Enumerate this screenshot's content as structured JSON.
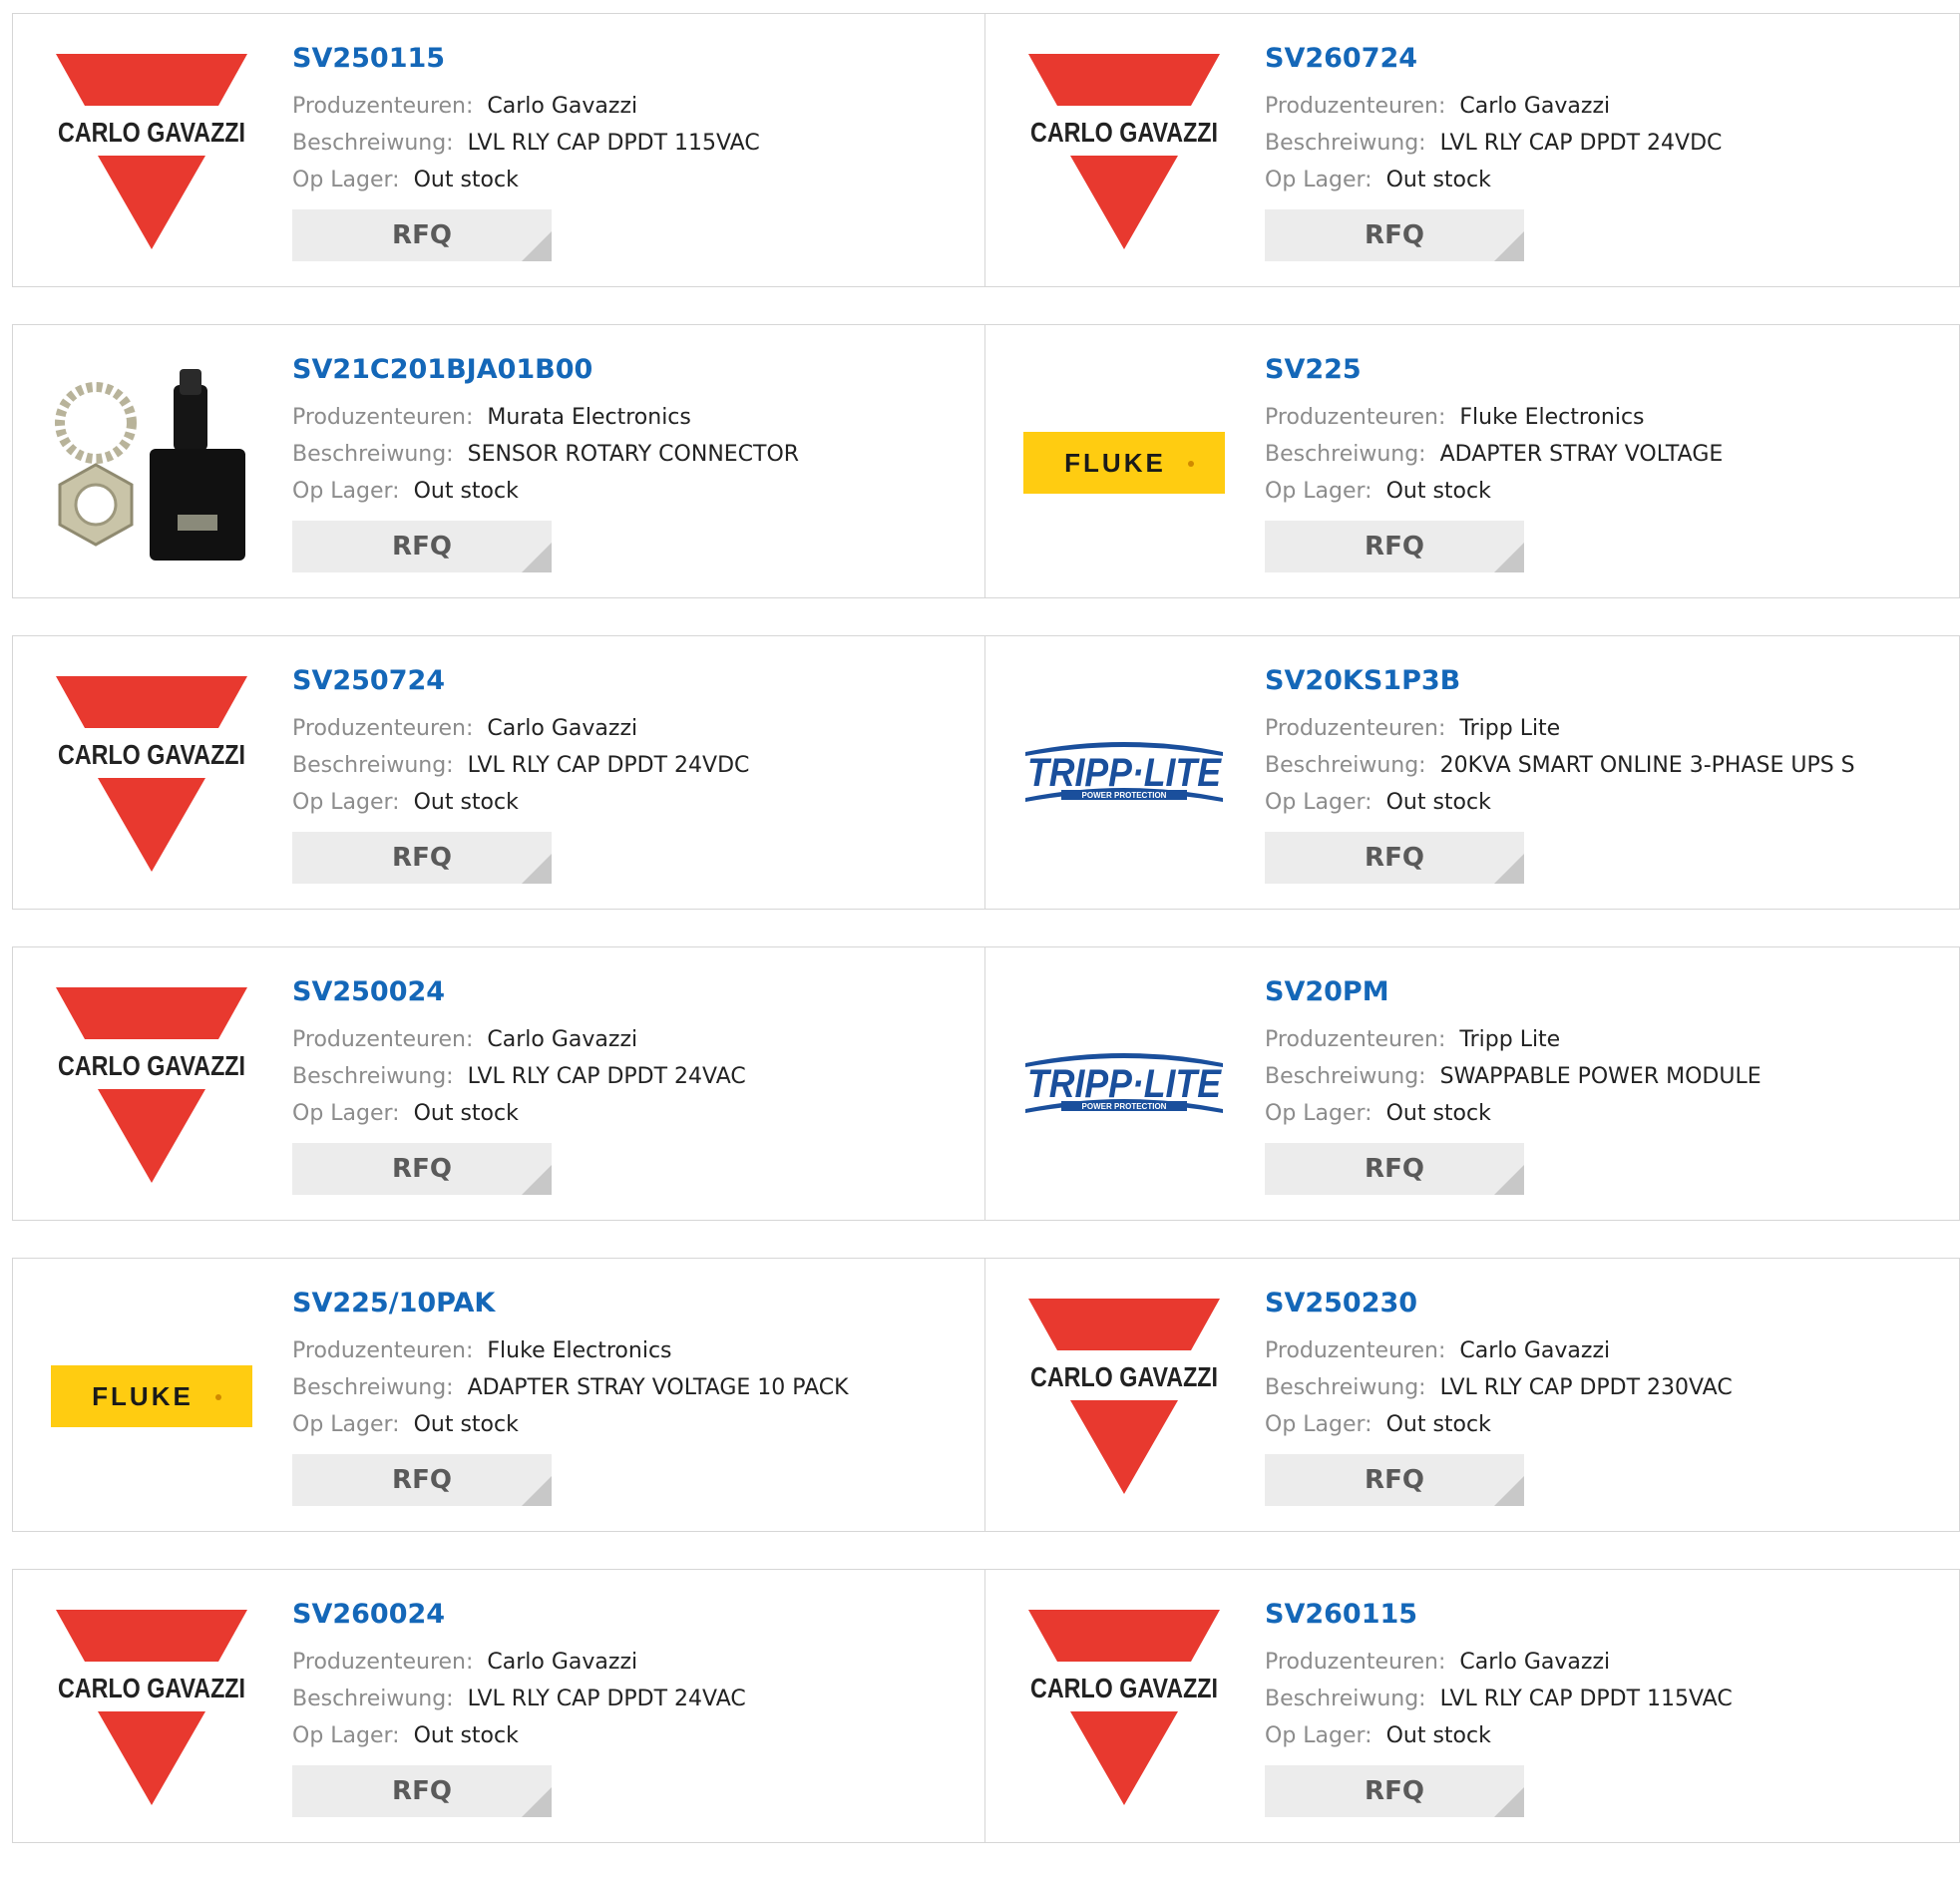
{
  "labels": {
    "manufacturer": "Produzenteuren:",
    "description": "Beschreiwung:",
    "stock": "Op Lager:",
    "rfq": "RFQ"
  },
  "logo_text": {
    "carlo_gavazzi": "CARLO GAVAZZI",
    "fluke": "FLUKE",
    "tripp_lite": "TRIPP·LITE",
    "tripp_lite_sub": "POWER PROTECTION"
  },
  "colors": {
    "part_number": "#1467b8",
    "carlo_gavazzi_red": "#e8392f",
    "fluke_yellow": "#ffcc11",
    "tripp_lite_blue": "#1a4f9c"
  },
  "products": [
    {
      "part": "SV250115",
      "logo": "carlo_gavazzi",
      "manufacturer": "Carlo Gavazzi",
      "description": "LVL RLY CAP DPDT 115VAC",
      "stock": "Out stock"
    },
    {
      "part": "SV260724",
      "logo": "carlo_gavazzi",
      "manufacturer": "Carlo Gavazzi",
      "description": "LVL RLY CAP DPDT 24VDC",
      "stock": "Out stock"
    },
    {
      "part": "SV21C201BJA01B00",
      "logo": "sensor_photo",
      "manufacturer": "Murata Electronics",
      "description": "SENSOR ROTARY CONNECTOR",
      "stock": "Out stock"
    },
    {
      "part": "SV225",
      "logo": "fluke",
      "manufacturer": "Fluke Electronics",
      "description": "ADAPTER STRAY VOLTAGE",
      "stock": "Out stock"
    },
    {
      "part": "SV250724",
      "logo": "carlo_gavazzi",
      "manufacturer": "Carlo Gavazzi",
      "description": "LVL RLY CAP DPDT 24VDC",
      "stock": "Out stock"
    },
    {
      "part": "SV20KS1P3B",
      "logo": "tripp_lite",
      "manufacturer": "Tripp Lite",
      "description": "20KVA SMART ONLINE 3-PHASE UPS S",
      "stock": "Out stock"
    },
    {
      "part": "SV250024",
      "logo": "carlo_gavazzi",
      "manufacturer": "Carlo Gavazzi",
      "description": "LVL RLY CAP DPDT 24VAC",
      "stock": "Out stock"
    },
    {
      "part": "SV20PM",
      "logo": "tripp_lite",
      "manufacturer": "Tripp Lite",
      "description": "SWAPPABLE POWER MODULE",
      "stock": "Out stock"
    },
    {
      "part": "SV225/10PAK",
      "logo": "fluke",
      "manufacturer": "Fluke Electronics",
      "description": "ADAPTER STRAY VOLTAGE 10 PACK",
      "stock": "Out stock"
    },
    {
      "part": "SV250230",
      "logo": "carlo_gavazzi",
      "manufacturer": "Carlo Gavazzi",
      "description": "LVL RLY CAP DPDT 230VAC",
      "stock": "Out stock"
    },
    {
      "part": "SV260024",
      "logo": "carlo_gavazzi",
      "manufacturer": "Carlo Gavazzi",
      "description": "LVL RLY CAP DPDT 24VAC",
      "stock": "Out stock"
    },
    {
      "part": "SV260115",
      "logo": "carlo_gavazzi",
      "manufacturer": "Carlo Gavazzi",
      "description": "LVL RLY CAP DPDT 115VAC",
      "stock": "Out stock"
    }
  ]
}
